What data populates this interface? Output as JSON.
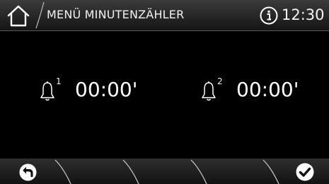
{
  "header": {
    "title": "MENÜ MINUTENZÄHLER",
    "time": "12:30",
    "icons": {
      "home": "home-icon",
      "info": "info-icon"
    }
  },
  "timers": [
    {
      "index": "1",
      "value": "00:00'",
      "icon": "bell-icon"
    },
    {
      "index": "2",
      "value": "00:00'",
      "icon": "bell-icon"
    }
  ],
  "footer": {
    "icons": {
      "back": "back-arrow-icon",
      "confirm": "checkmark-icon"
    }
  },
  "colors": {
    "background": "#000000",
    "header_bar": "#2b2b2b",
    "footer_bar": "#1e1e1e",
    "text": "#ffffff"
  }
}
